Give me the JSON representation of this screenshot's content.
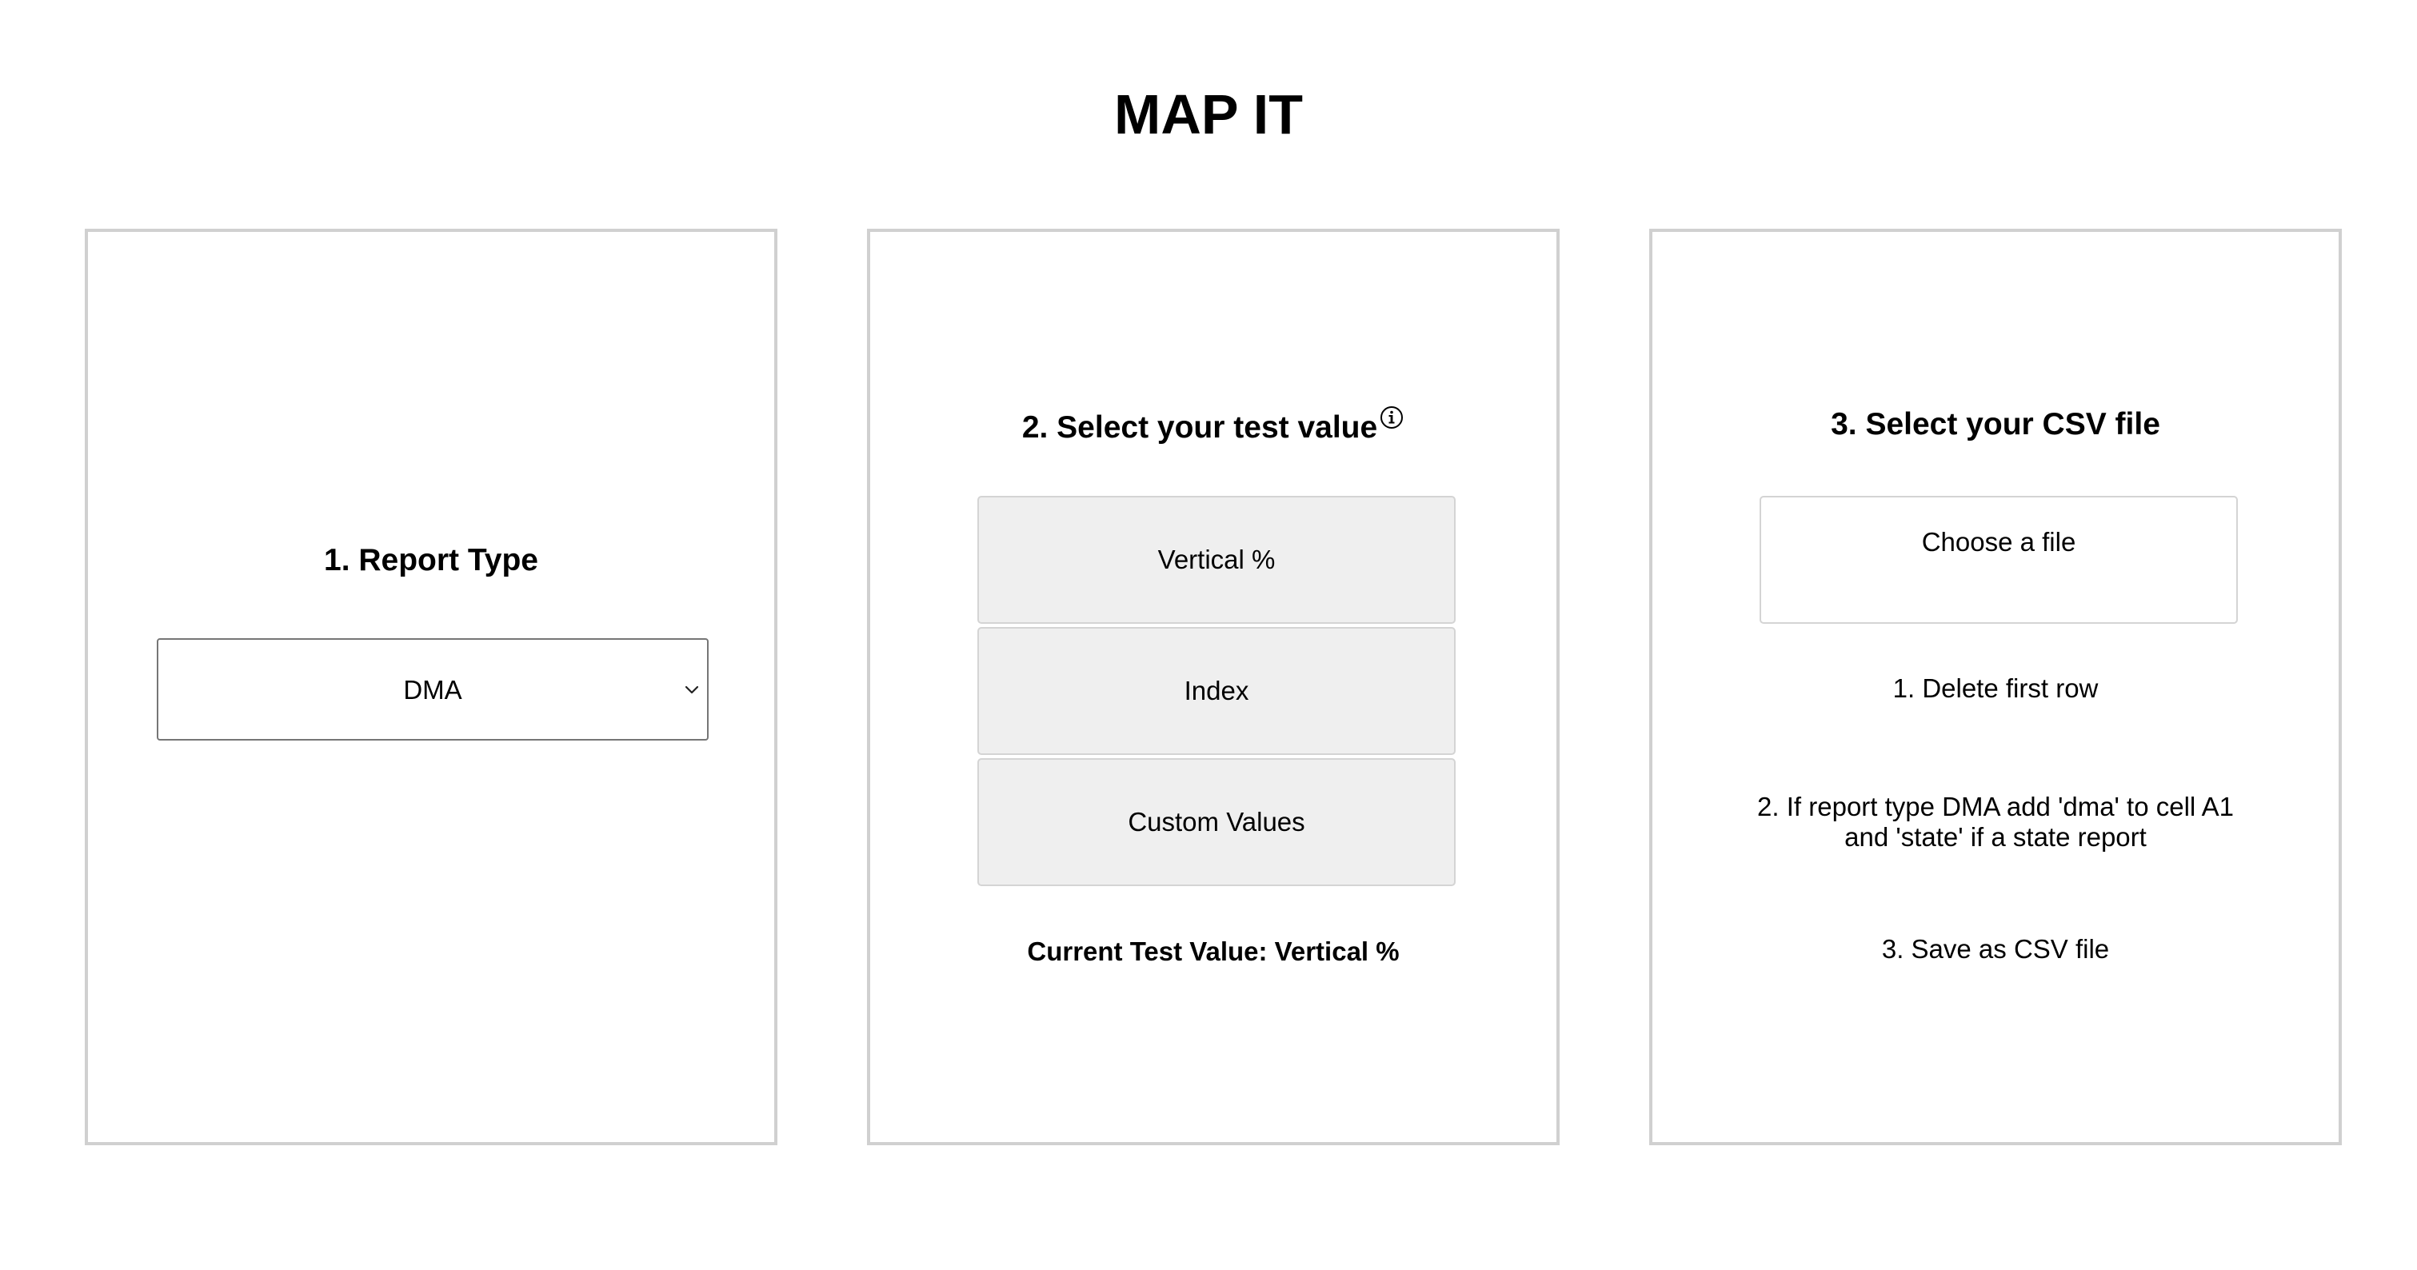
{
  "app": {
    "title": "MAP IT"
  },
  "report_type": {
    "heading": "1. Report Type",
    "selected": "DMA"
  },
  "test_value": {
    "heading": "2. Select your test value",
    "options": [
      "Vertical %",
      "Index",
      "Custom Values"
    ],
    "current_label": "Current Test Value: Vertical %"
  },
  "csv": {
    "heading": "3. Select your CSV file",
    "file_button": "Choose a file",
    "steps": [
      "1. Delete first row",
      "2. If report type DMA add 'dma' to cell A1 and 'state' if a state report",
      "3. Save as CSV file"
    ]
  },
  "icons": {
    "info": "info-icon",
    "chevron": "chevron-down-icon"
  }
}
